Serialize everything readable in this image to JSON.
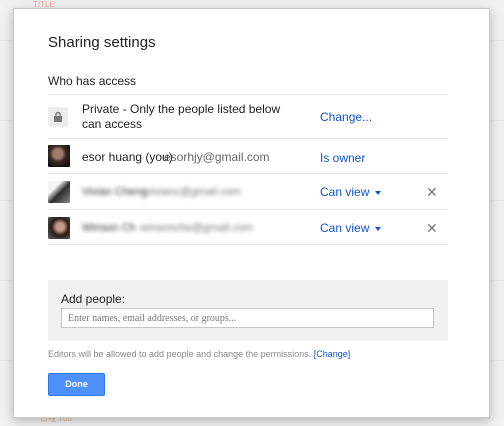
{
  "background": {
    "title": "TITLE",
    "footer": "日程 Tdd"
  },
  "dialog": {
    "title": "Sharing settings",
    "who_has_access": "Who has access",
    "visibility": {
      "text": "Private - Only the people listed below can access",
      "change_label": "Change...",
      "icon": "lock-icon"
    },
    "owner": {
      "name": "esor huang (you)",
      "email": "esorhjy@gmail.com",
      "role": "Is owner"
    },
    "collaborators": [
      {
        "name": "Vivian Cheng",
        "email": "vivianc@gmail.com",
        "role": "Can view"
      },
      {
        "name": "Winson Ch",
        "email": "winsonche@gmail.com",
        "role": "Can view"
      }
    ],
    "remove_symbol": "✕",
    "add_people": {
      "label": "Add people:",
      "placeholder": "Enter names, email addresses, or groups..."
    },
    "editors_note": "Editors will be allowed to add people and change the permissions.",
    "editors_change": "[Change]",
    "done_label": "Done"
  },
  "colors": {
    "link": "#1155cc",
    "primary_button": "#4d90fe"
  }
}
